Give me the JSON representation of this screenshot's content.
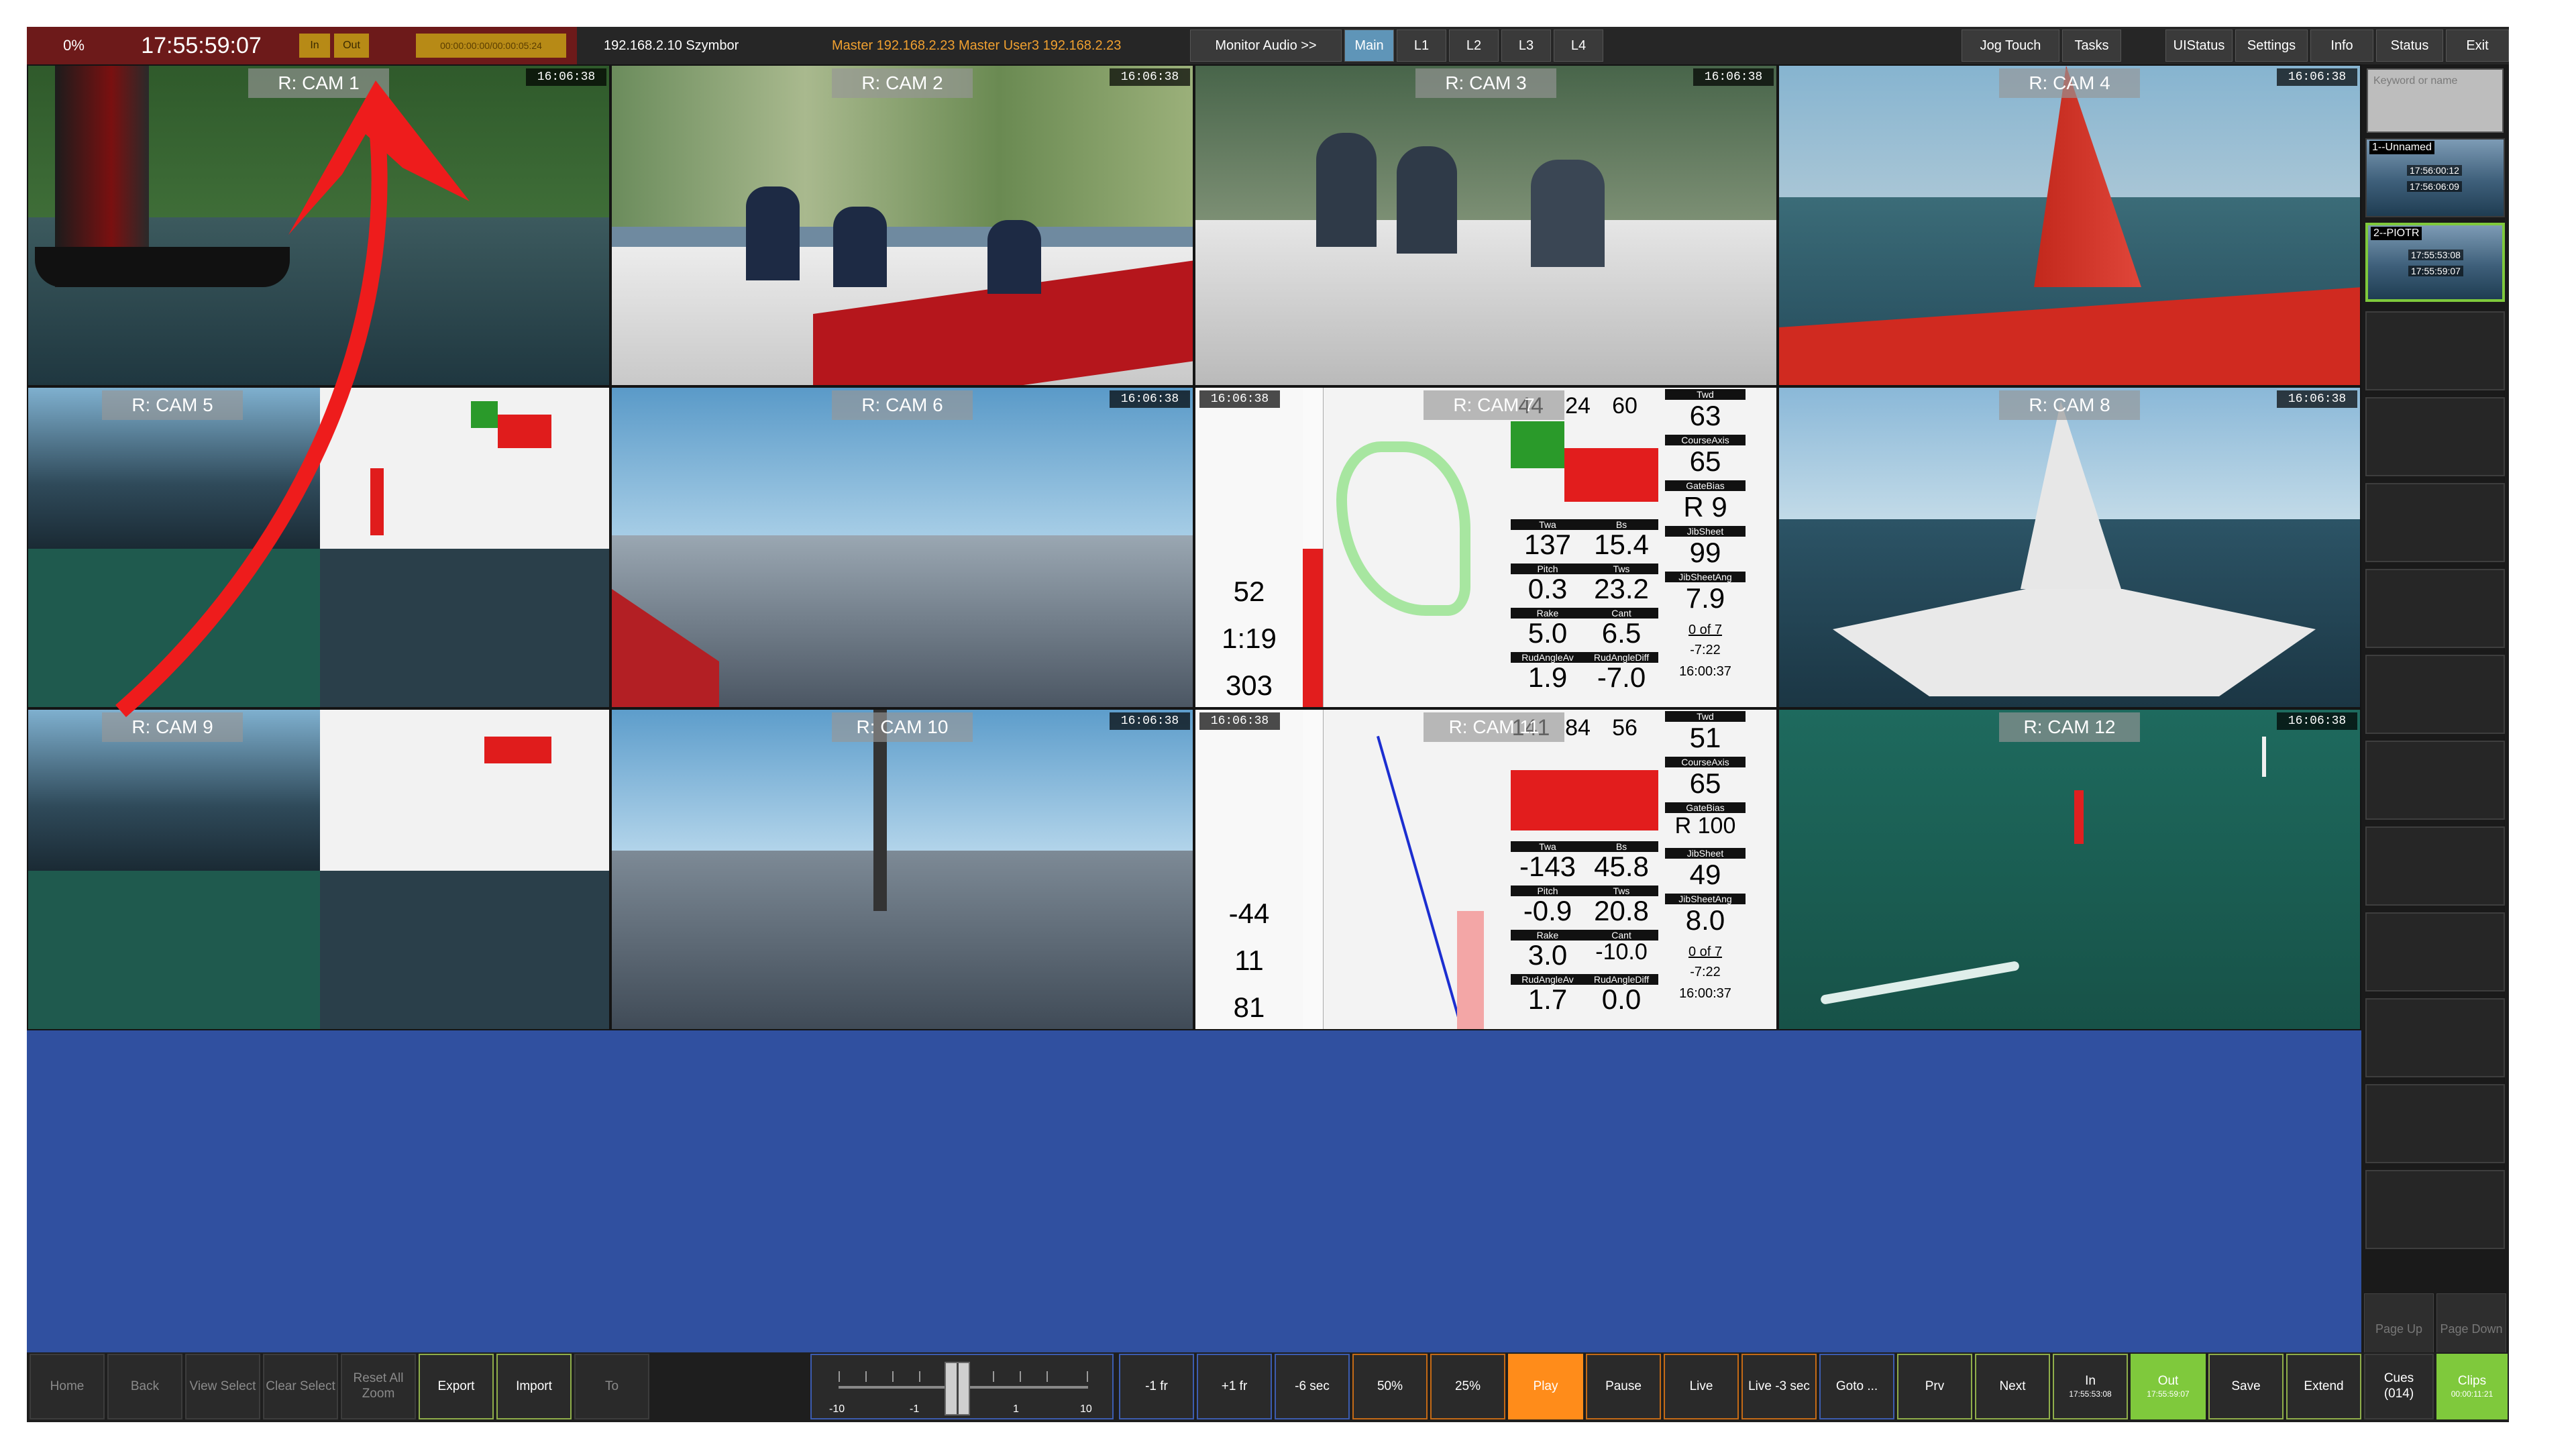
{
  "topbar": {
    "percent": "0%",
    "clock": "17:55:59:07",
    "in_label": "In",
    "out_label": "Out",
    "timecode": "00:00:00:00/00:00:05:24",
    "host": "192.168.2.10 Szymbor",
    "master": "Master 192.168.2.23  Master  User3  192.168.2.23",
    "buttons": [
      "Monitor Audio >>",
      "Main",
      "L1",
      "L2",
      "L3",
      "L4"
    ],
    "right_buttons": [
      "Jog Touch",
      "Tasks",
      "UIStatus",
      "Settings",
      "Info",
      "Status",
      "Exit"
    ]
  },
  "cams": [
    {
      "label": "R: CAM 1",
      "ts": "16:06:38"
    },
    {
      "label": "R: CAM 2",
      "ts": "16:06:38"
    },
    {
      "label": "R: CAM 3",
      "ts": "16:06:38"
    },
    {
      "label": "R: CAM 4",
      "ts": "16:06:38"
    },
    {
      "label": "R: CAM 5",
      "ts": ""
    },
    {
      "label": "R: CAM 6",
      "ts": "16:06:38"
    },
    {
      "label": "R: CAM 7",
      "ts": "16:06:38"
    },
    {
      "label": "R: CAM 8",
      "ts": "16:06:38"
    },
    {
      "label": "R: CAM 9",
      "ts": ""
    },
    {
      "label": "R: CAM 10",
      "ts": "16:06:38"
    },
    {
      "label": "R: CAM 11",
      "ts": "16:06:38"
    },
    {
      "label": "R: CAM 12",
      "ts": "16:06:38"
    }
  ],
  "telemetry_top": {
    "head": [
      "44",
      "24",
      "60"
    ],
    "twd": "63",
    "twd_lbl": "Twd",
    "course": "65",
    "course_lbl": "CourseAxis",
    "gatebias": "R 9",
    "gatebias_lbl": "GateBias",
    "twa": "137",
    "bs": "15.4",
    "twa_lbl": "Twa",
    "bs_lbl": "Bs",
    "jib": "99",
    "jib_lbl": "JibSheet",
    "pitch": "0.3",
    "tws": "23.2",
    "pitch_lbl": "Pitch",
    "tws_lbl": "Tws",
    "jibang": "7.9",
    "jibang_lbl": "JibSheetAng",
    "rake": "5.0",
    "cant": "6.5",
    "rake_lbl": "Rake",
    "cant_lbl": "Cant",
    "rud": "1.9",
    "ruddiff": "-7.0",
    "rud_lbl": "RudAngleAv",
    "ruddiff_lbl": "RudAngleDiff",
    "left1": "52",
    "left2": "1:19",
    "left3": "303",
    "of": "0 of 7",
    "neg": "-7:22",
    "time": "16:00:37"
  },
  "telemetry_bottom": {
    "head": [
      "141",
      "84",
      "56"
    ],
    "twd": "51",
    "course": "65",
    "gatebias": "R 100",
    "twa": "-143",
    "bs": "45.8",
    "jib": "49",
    "pitch": "-0.9",
    "tws": "20.8",
    "jibang": "8.0",
    "rake": "3.0",
    "cant": "-10.0",
    "rud": "1.7",
    "ruddiff": "0.0",
    "left1": "-44",
    "left2": "11",
    "left3": "81",
    "of": "0 of 7",
    "neg": "-7:22",
    "time": "16:00:37"
  },
  "sidebar": {
    "search_placeholder": "Keyword or name",
    "clips": [
      {
        "name": "1--Unnamed",
        "t1": "17:56:00:12",
        "t2": "17:56:06:09"
      },
      {
        "name": "2--PIOTR",
        "t1": "17:55:53:08",
        "t2": "17:55:59:07"
      }
    ],
    "page_up": "Page Up",
    "page_down": "Page Down"
  },
  "bottombar": {
    "home": "Home",
    "back": "Back",
    "view_select": "View Select",
    "clear_select": "Clear Select",
    "reset_zoom": "Reset All Zoom",
    "export": "Export",
    "import": "Import",
    "to": "To",
    "jog_labels": [
      "-10",
      "-1",
      "1",
      "10"
    ],
    "minus_fr": "-1 fr",
    "plus_fr": "+1 fr",
    "minus6": "-6 sec",
    "p50": "50%",
    "p25": "25%",
    "play": "Play",
    "pause": "Pause",
    "live": "Live",
    "live3": "Live -3 sec",
    "goto": "Goto ...",
    "prv": "Prv",
    "next": "Next",
    "in": "In",
    "in_tc": "17:55:53:08",
    "out": "Out",
    "out_tc": "17:55:59:07",
    "save": "Save",
    "extend": "Extend",
    "cues": "Cues",
    "cues_count": "(014)",
    "clips": "Clips",
    "clips_tc": "00:00:11:21"
  },
  "colors": {
    "accent_blue": "#3050a0",
    "play_orange": "#ff8c1a",
    "selected_green": "#7fc93c",
    "arrow_red": "#ee1c1c"
  }
}
